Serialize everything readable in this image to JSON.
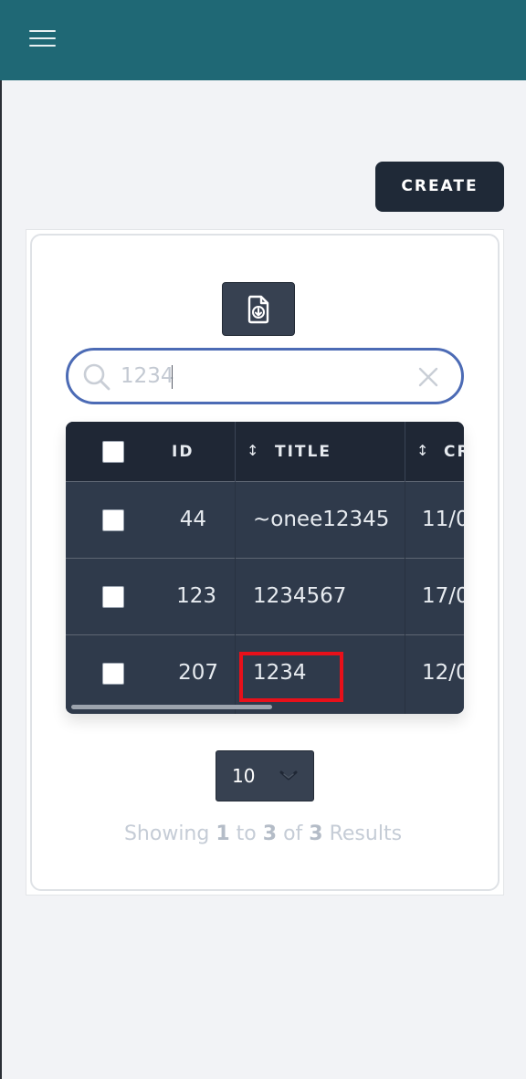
{
  "header": {
    "menu_icon": "hamburger-menu-icon",
    "background_color": "#1f6875"
  },
  "toolbar": {
    "create_label": "CREATE",
    "export_icon": "file-download-icon"
  },
  "search": {
    "value": "1234",
    "search_icon": "search-icon",
    "clear_icon": "close-icon"
  },
  "table": {
    "columns": [
      {
        "label": "ID",
        "sortable": false
      },
      {
        "label": "TITLE",
        "sortable": true
      },
      {
        "label": "CR",
        "sortable": true
      }
    ],
    "rows": [
      {
        "id": "44",
        "title": "~onee12345",
        "created": "11/0"
      },
      {
        "id": "123",
        "title": "1234567",
        "created": "17/0"
      },
      {
        "id": "207",
        "title": "1234",
        "created": "12/0"
      }
    ],
    "highlighted_cell": "1234"
  },
  "pagination": {
    "page_size": "10",
    "results_prefix": "Showing",
    "from": "1",
    "to_word": "to",
    "to": "3",
    "of_word": "of",
    "total": "3",
    "results_suffix": "Results"
  }
}
